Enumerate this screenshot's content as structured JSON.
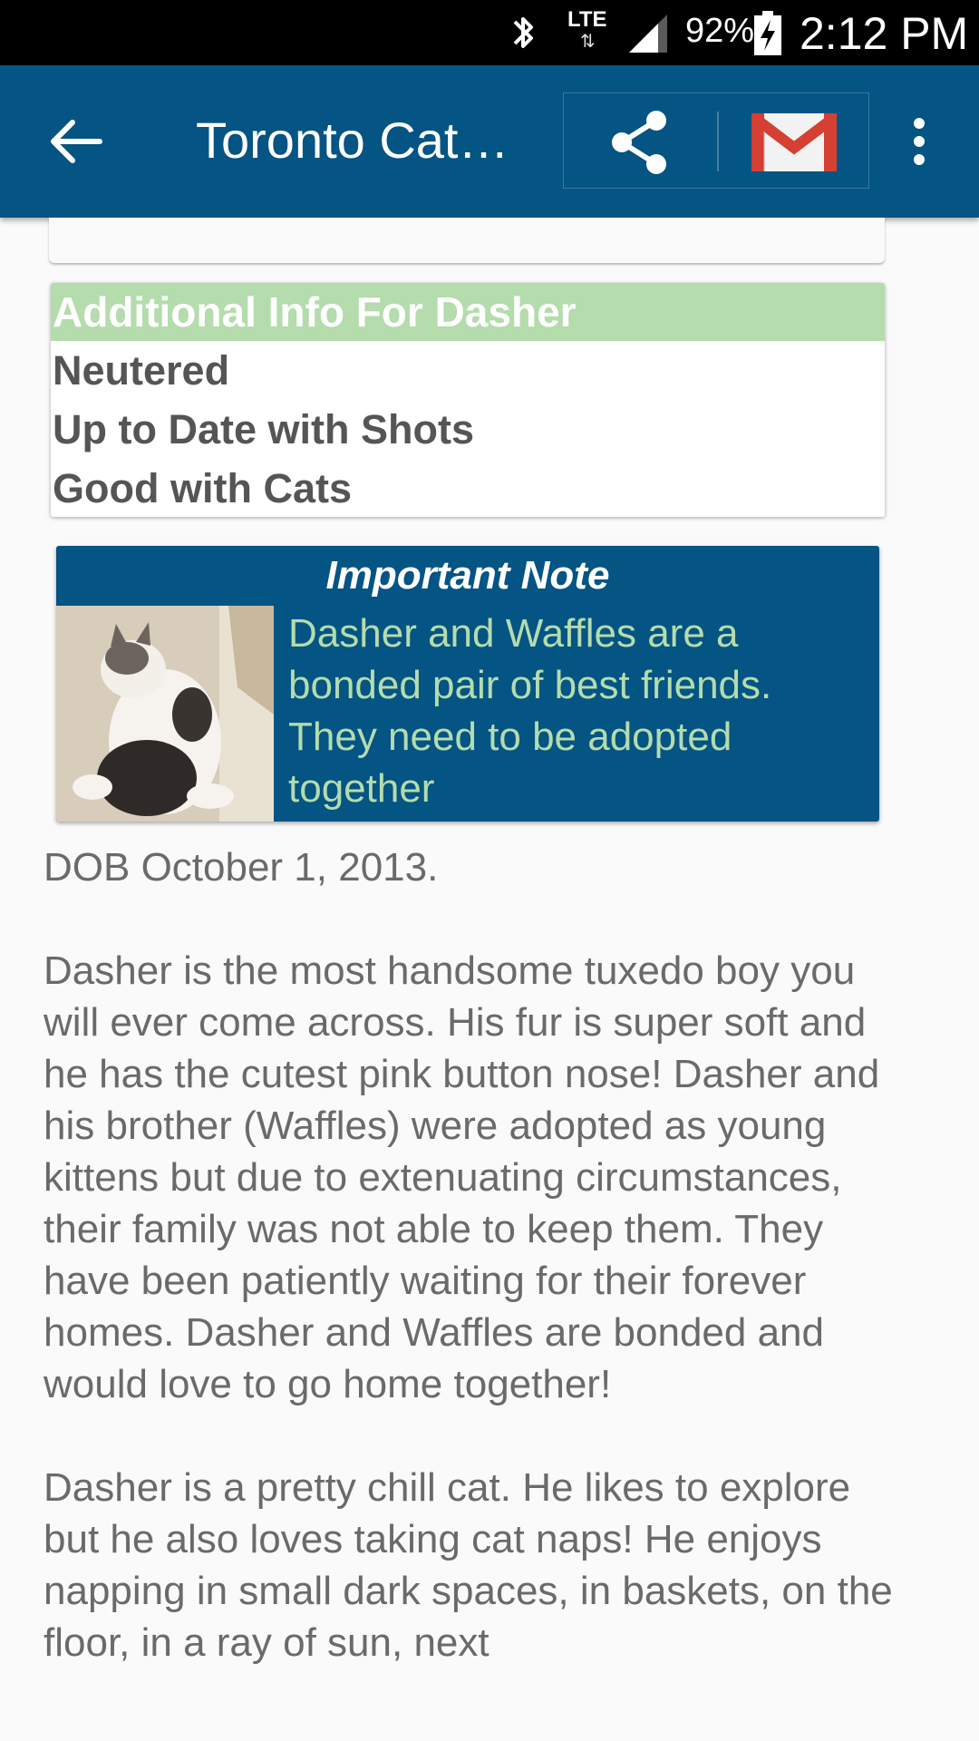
{
  "status_bar": {
    "network": "LTE",
    "battery_percent": "92%",
    "time": "2:12 PM",
    "icons": [
      "bluetooth-icon",
      "lte-icon",
      "signal-icon",
      "battery-charging-icon"
    ]
  },
  "app_bar": {
    "title": "Toronto Cat…",
    "icons": [
      "back-arrow-icon",
      "share-icon",
      "gmail-icon",
      "overflow-menu-icon"
    ],
    "color": "#045484"
  },
  "info_card": {
    "header": "Additional Info For Dasher",
    "header_color": "#b4dcac",
    "items": [
      "Neutered",
      "Up to Date with Shots",
      "Good with Cats"
    ]
  },
  "important_note": {
    "title": "Important Note",
    "text": "Dasher and Waffles are a bonded pair of best friends. They need to be adopted together",
    "text_color": "#b4dcac"
  },
  "description": {
    "dob": "DOB October 1, 2013.",
    "paragraph1": "Dasher is the most handsome tuxedo boy you will ever come across. His fur is super soft and he has the cutest pink button nose! Dasher and his brother (Waffles) were adopted as young kittens but due to extenuating circumstances, their family was not able to keep them. They have been patiently waiting for their forever homes. Dasher and Waffles are bonded and would love to go home together!",
    "paragraph2": "Dasher is a pretty chill cat. He likes to explore but he also loves taking cat naps! He enjoys napping in small dark spaces, in baskets, on the floor, in a ray of sun, next"
  }
}
